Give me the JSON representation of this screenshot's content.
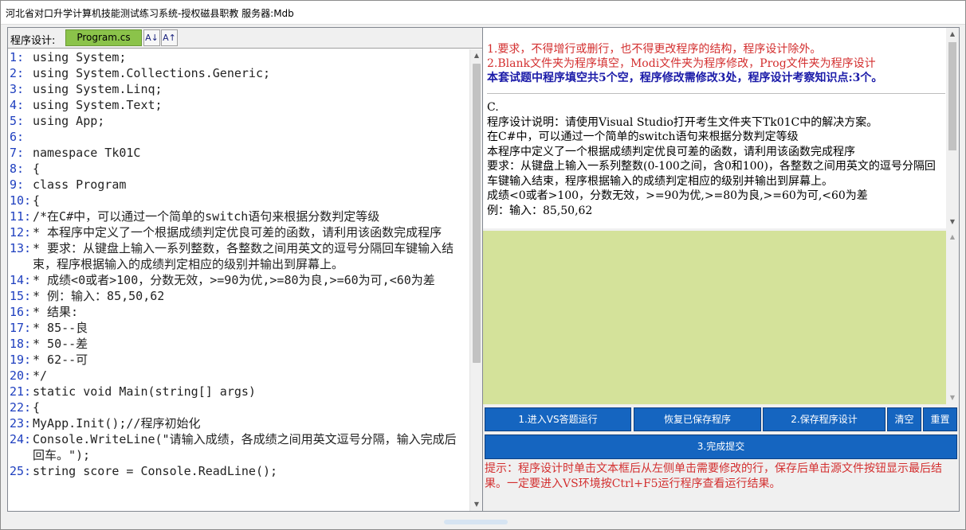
{
  "window": {
    "title": "河北省对口升学计算机技能测试练习系统-授权磁县职教  服务器:Mdb"
  },
  "left": {
    "section_label": "程序设计:",
    "file_tab": "Program.cs",
    "sort_asc_label": "A↓",
    "sort_desc_label": "A↑",
    "code_lines": [
      {
        "n": "1:",
        "t": "using System;"
      },
      {
        "n": "2:",
        "t": "using System.Collections.Generic;"
      },
      {
        "n": "3:",
        "t": "using System.Linq;"
      },
      {
        "n": "4:",
        "t": "using System.Text;"
      },
      {
        "n": "5:",
        "t": "using App;"
      },
      {
        "n": "6:",
        "t": ""
      },
      {
        "n": "7:",
        "t": "namespace Tk01C"
      },
      {
        "n": "8:",
        "t": "{"
      },
      {
        "n": "9:",
        "t": "class Program"
      },
      {
        "n": "10:",
        "t": "{"
      },
      {
        "n": "11:",
        "t": "/*在C#中，可以通过一个简单的switch语句来根据分数判定等级"
      },
      {
        "n": "12:",
        "t": "* 本程序中定义了一个根据成绩判定优良可差的函数，请利用该函数完成程序"
      },
      {
        "n": "13:",
        "t": "* 要求：从键盘上输入一系列整数，各整数之间用英文的逗号分隔回车键输入结束，程序根据输入的成绩判定相应的级别并输出到屏幕上。"
      },
      {
        "n": "14:",
        "t": "* 成绩<0或者>100，分数无效，>=90为优,>=80为良,>=60为可,<60为差"
      },
      {
        "n": "15:",
        "t": "* 例：输入：85,50,62"
      },
      {
        "n": "16:",
        "t": "* 结果:"
      },
      {
        "n": "17:",
        "t": "* 85--良"
      },
      {
        "n": "18:",
        "t": "* 50--差"
      },
      {
        "n": "19:",
        "t": "* 62--可"
      },
      {
        "n": "20:",
        "t": "*/"
      },
      {
        "n": "21:",
        "t": "static void Main(string[] args)"
      },
      {
        "n": "22:",
        "t": "{"
      },
      {
        "n": "23:",
        "t": "MyApp.Init();//程序初始化"
      },
      {
        "n": "24:",
        "t": "Console.WriteLine(\"请输入成绩，各成绩之间用英文逗号分隔，输入完成后回车。\");"
      },
      {
        "n": "25:",
        "t": "string score = Console.ReadLine();"
      }
    ]
  },
  "right": {
    "req1": "1.要求，不得增行或删行，也不得更改程序的结构，程序设计除外。",
    "req2": "2.Blank文件夹为程序填空，Modi文件夹为程序修改，Prog文件夹为程序设计",
    "summary": "本套试题中程序填空共5个空，程序修改需修改3处，程序设计考察知识点:3个。",
    "section": "C.",
    "desc_lines": [
      "程序设计说明：请使用Visual Studio打开考生文件夹下Tk01C中的解决方案。",
      "在C#中，可以通过一个简单的switch语句来根据分数判定等级",
      "本程序中定义了一个根据成绩判定优良可差的函数，请利用该函数完成程序",
      "要求：从键盘上输入一系列整数(0-100之间，含0和100)，各整数之间用英文的逗号分隔回车键输入结束，程序根据输入的成绩判定相应的级别并输出到屏幕上。",
      "成绩<0或者>100，分数无效，>=90为优,>=80为良,>=60为可,<60为差",
      "例：输入：85,50,62"
    ],
    "buttons": {
      "enter_vs": "1.进入VS答题运行",
      "restore": "恢复已保存程序",
      "save": "2.保存程序设计",
      "clear": "清空",
      "reset": "重置",
      "submit": "3.完成提交"
    },
    "tip": "提示：程序设计时单击文本框后从左侧单击需要修改的行，保存后单击源文件按钮显示最后结果。一定要进入VS环境按Ctrl+F5运行程序查看运行结果。"
  },
  "colors": {
    "button_blue": "#1565c0",
    "tab_green": "#8bc34a",
    "editor_green": "#d4e29a",
    "instruction_red": "#d32f2f",
    "summary_blue": "#1a1aa8",
    "line_number_blue": "#1e3fbf"
  }
}
